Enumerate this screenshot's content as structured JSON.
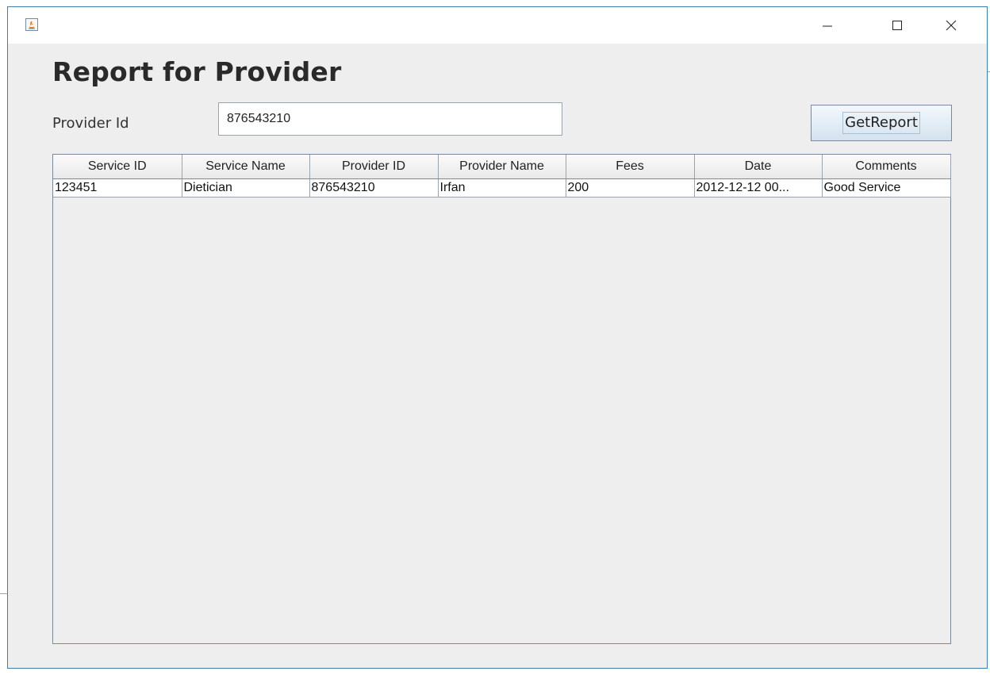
{
  "window": {
    "title": "",
    "controls": {
      "minimize_icon": "minimize-icon",
      "maximize_icon": "maximize-icon",
      "close_icon": "close-icon"
    }
  },
  "form": {
    "heading": "Report for Provider",
    "provider_label": "Provider Id",
    "provider_value": "876543210",
    "button_label": "GetReport"
  },
  "table": {
    "columns": [
      "Service ID",
      "Service Name",
      "Provider ID",
      "Provider Name",
      "Fees",
      "Date",
      "Comments"
    ],
    "rows": [
      [
        "123451",
        "Dietician",
        "876543210",
        "Irfan",
        "200",
        "2012-12-12 00...",
        "Good Service"
      ]
    ]
  }
}
